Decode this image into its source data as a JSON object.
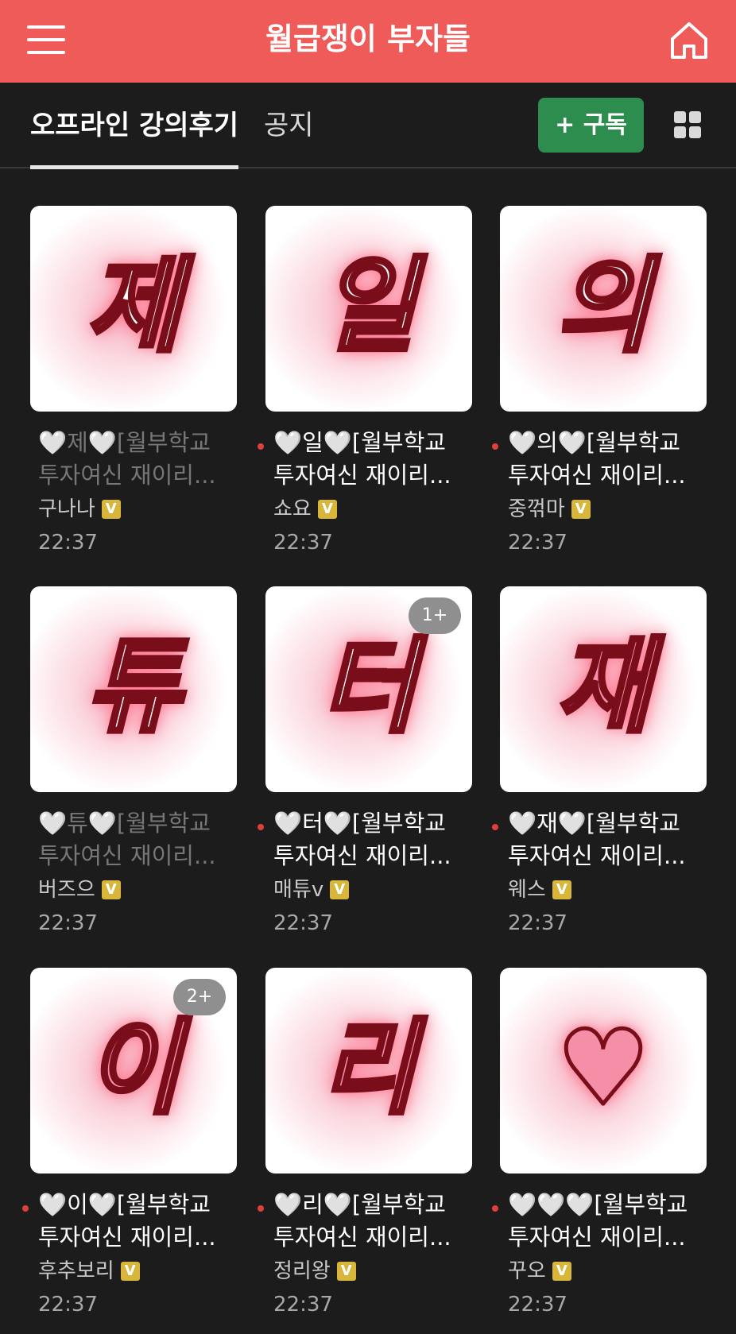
{
  "header": {
    "title": "월급쟁이 부자들"
  },
  "tabs": {
    "active": "오프라인 강의후기",
    "notice": "공지"
  },
  "subscribe_label": "+ 구독",
  "posts": [
    {
      "glyph": "제",
      "title1": "🤍제🤍[월부학교",
      "title2": "투자여신 재이리...",
      "author": "구나나",
      "time": "22:37",
      "badge": "",
      "unread": false
    },
    {
      "glyph": "일",
      "title1": "🤍일🤍[월부학교",
      "title2": "투자여신 재이리...",
      "author": "쇼요",
      "time": "22:37",
      "badge": "",
      "unread": true
    },
    {
      "glyph": "의",
      "title1": "🤍의🤍[월부학교",
      "title2": "투자여신 재이리...",
      "author": "중꺾마",
      "time": "22:37",
      "badge": "",
      "unread": true
    },
    {
      "glyph": "튜",
      "title1": "🤍튜🤍[월부학교",
      "title2": "투자여신 재이리...",
      "author": "버즈으",
      "time": "22:37",
      "badge": "",
      "unread": false
    },
    {
      "glyph": "터",
      "title1": "🤍터🤍[월부학교",
      "title2": "투자여신 재이리...",
      "author": "매튜v",
      "time": "22:37",
      "badge": "1+",
      "unread": true
    },
    {
      "glyph": "재",
      "title1": "🤍재🤍[월부학교",
      "title2": "투자여신 재이리...",
      "author": "웨스",
      "time": "22:37",
      "badge": "",
      "unread": true
    },
    {
      "glyph": "이",
      "title1": "🤍이🤍[월부학교",
      "title2": "투자여신 재이리...",
      "author": "후추보리",
      "time": "22:37",
      "badge": "2+",
      "unread": true
    },
    {
      "glyph": "리",
      "title1": "🤍리🤍[월부학교",
      "title2": "투자여신 재이리...",
      "author": "정리왕",
      "time": "22:37",
      "badge": "",
      "unread": true
    },
    {
      "glyph": "♥",
      "title1": "🤍🤍🤍[월부학교",
      "title2": "투자여신 재이리...",
      "author": "꾸오",
      "time": "22:37",
      "badge": "",
      "unread": true
    }
  ],
  "verified_label": "V",
  "colors": {
    "header": "#ee5b58",
    "subscribe": "#2c8d4f",
    "background": "#1c1c1c",
    "unread_dot": "#e0403a",
    "verified": "#d8b63a"
  },
  "icons": {
    "menu": "hamburger-menu-icon",
    "home": "home-icon",
    "view": "grid-view-icon"
  }
}
